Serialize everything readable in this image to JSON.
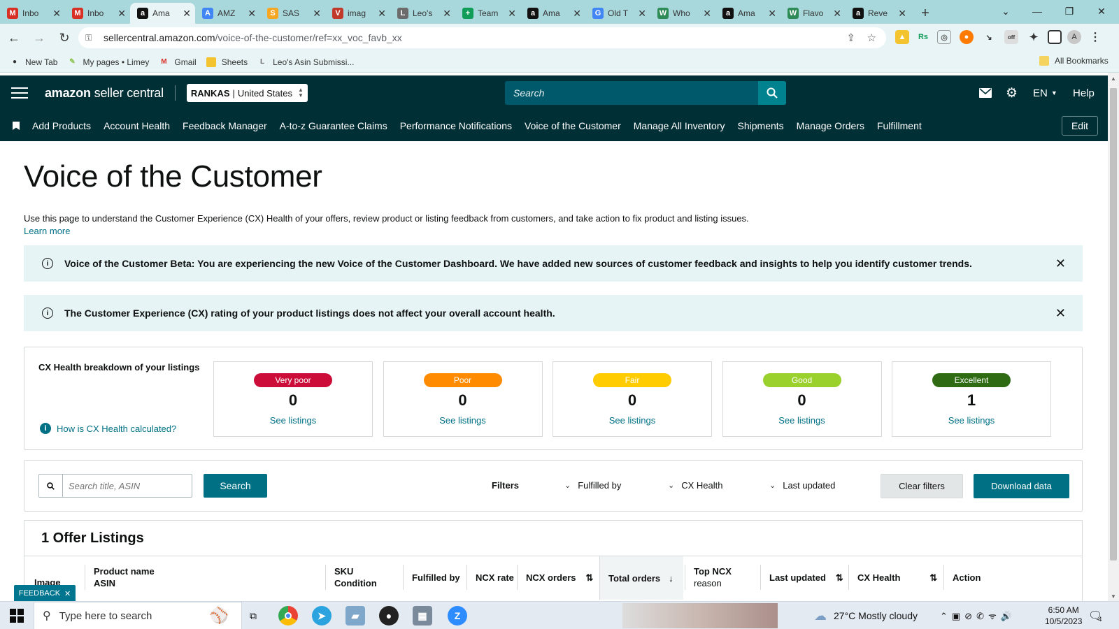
{
  "browser": {
    "tabs": [
      {
        "label": "Inbo",
        "icon": "gmail-icon",
        "color": "#d93025",
        "glyph": "M",
        "active": false
      },
      {
        "label": "Inbo",
        "icon": "gmail-icon",
        "color": "#d93025",
        "glyph": "M",
        "active": false
      },
      {
        "label": "Ama",
        "icon": "amazon-icon",
        "color": "#111111",
        "glyph": "a",
        "active": true
      },
      {
        "label": "AMZ",
        "icon": "amz-icon",
        "color": "#4285f4",
        "glyph": "A",
        "active": false
      },
      {
        "label": "SAS",
        "icon": "sas-icon",
        "color": "#f5a623",
        "glyph": "S",
        "active": false
      },
      {
        "label": "imag",
        "icon": "image-icon",
        "color": "#c0392b",
        "glyph": "V",
        "active": false
      },
      {
        "label": "Leo's",
        "icon": "leo-icon",
        "color": "#6c6c6c",
        "glyph": "L",
        "active": false
      },
      {
        "label": "Team",
        "icon": "sheets-icon",
        "color": "#0f9d58",
        "glyph": "+",
        "active": false
      },
      {
        "label": "Ama",
        "icon": "amazon-icon",
        "color": "#111111",
        "glyph": "a",
        "active": false
      },
      {
        "label": "Old T",
        "icon": "google-icon",
        "color": "#4285f4",
        "glyph": "G",
        "active": false
      },
      {
        "label": "Who",
        "icon": "w-icon",
        "color": "#2e8b57",
        "glyph": "W",
        "active": false
      },
      {
        "label": "Ama",
        "icon": "amazon-icon",
        "color": "#111111",
        "glyph": "a",
        "active": false
      },
      {
        "label": "Flavo",
        "icon": "w-icon",
        "color": "#2e8b57",
        "glyph": "W",
        "active": false
      },
      {
        "label": "Reve",
        "icon": "amazon-icon",
        "color": "#111111",
        "glyph": "a",
        "active": false
      }
    ],
    "url_host": "sellercentral.amazon.com",
    "url_path": "/voice-of-the-customer/ref=xx_voc_favb_xx",
    "bookmarks": [
      {
        "label": "New Tab",
        "color": "#333333",
        "glyph": "●"
      },
      {
        "label": "My pages • Limey",
        "color": "#8bc34a",
        "glyph": "✎"
      },
      {
        "label": "Gmail",
        "color": "#d93025",
        "glyph": "M"
      },
      {
        "label": "Sheets",
        "color": "#f4c430",
        "glyph": " "
      },
      {
        "label": "Leo's Asin Submissi...",
        "color": "#6c6c6c",
        "glyph": "L"
      }
    ],
    "all_bookmarks": "All Bookmarks",
    "profile": "A"
  },
  "header": {
    "logo_brand": "amazon",
    "logo_product": "seller central",
    "account_store": "RANKAS",
    "account_market": "United States",
    "search_placeholder": "Search",
    "language": "EN",
    "help": "Help"
  },
  "nav": {
    "items": [
      "Add Products",
      "Account Health",
      "Feedback Manager",
      "A-to-z Guarantee Claims",
      "Performance Notifications",
      "Voice of the Customer",
      "Manage All Inventory",
      "Shipments",
      "Manage Orders",
      "Fulfillment"
    ],
    "edit": "Edit"
  },
  "page": {
    "title": "Voice of the Customer",
    "description": "Use this page to understand the Customer Experience (CX) Health of your offers, review product or listing feedback from customers, and take action to fix product and listing issues.",
    "learn_more": "Learn more"
  },
  "alerts": [
    {
      "text": "Voice of the Customer Beta: You are experiencing the new Voice of the Customer Dashboard. We have added new sources of customer feedback and insights to help you identify customer trends."
    },
    {
      "text": "The Customer Experience (CX) rating of your product listings does not affect your overall account health."
    }
  ],
  "health": {
    "title": "CX Health breakdown of your listings",
    "calc_link": "How is CX Health calculated?",
    "cards": [
      {
        "label": "Very poor",
        "count": "0",
        "link": "See listings",
        "color": "#cc0c39"
      },
      {
        "label": "Poor",
        "count": "0",
        "link": "See listings",
        "color": "#ff8c00"
      },
      {
        "label": "Fair",
        "count": "0",
        "link": "See listings",
        "color": "#ffcc00"
      },
      {
        "label": "Good",
        "count": "0",
        "link": "See listings",
        "color": "#9bd12c"
      },
      {
        "label": "Excellent",
        "count": "1",
        "link": "See listings",
        "color": "#2e6b12"
      }
    ]
  },
  "filters": {
    "search_placeholder": "Search title, ASIN",
    "search_button": "Search",
    "label": "Filters",
    "dropdowns": [
      "Fulfilled by",
      "CX Health",
      "Last updated"
    ],
    "clear": "Clear filters",
    "download": "Download data"
  },
  "listings": {
    "title": "1 Offer Listings",
    "columns": {
      "image": "Image",
      "product_name": "Product name",
      "asin": "ASIN",
      "sku": "SKU",
      "condition": "Condition",
      "fulfilled_by": "Fulfilled by",
      "ncx_rate": "NCX rate",
      "ncx_orders": "NCX orders",
      "total_orders": "Total orders",
      "top_ncx": "Top NCX",
      "reason": "reason",
      "last_updated": "Last updated",
      "cx_health": "CX Health",
      "action": "Action"
    }
  },
  "feedback": "FEEDBACK",
  "taskbar": {
    "search_placeholder": "Type here to search",
    "weather": "27°C  Mostly cloudy",
    "time": "6:50 AM",
    "date": "10/5/2023",
    "notifications": "4"
  }
}
